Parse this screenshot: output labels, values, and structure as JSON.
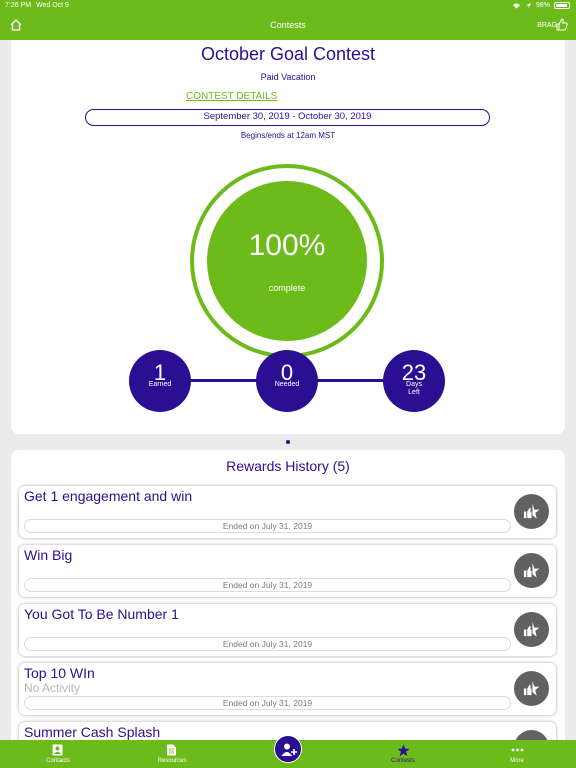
{
  "status_bar": {
    "time": "7:26 PM",
    "date": "Wed Oct 9",
    "battery": "98%"
  },
  "nav": {
    "title": "Contests",
    "brag_label": "BRAG"
  },
  "contest": {
    "title": "October Goal Contest",
    "prize": "Paid Vacation",
    "details_link": "CONTEST DETAILS",
    "date_range": "September 30, 2019 - October 30, 2019",
    "begins_ends": "Begins/ends at 12am MST",
    "progress_text": "100%",
    "progress_label": "complete",
    "progress_fraction": 1.0,
    "stats": {
      "earned": {
        "value": "1",
        "label": "Earned"
      },
      "needed": {
        "value": "0",
        "label": "Needed"
      },
      "days_left": {
        "value": "23",
        "label_top": "Days",
        "label_bottom": "Left"
      }
    }
  },
  "rewards": {
    "title": "Rewards History (5)",
    "items": [
      {
        "name": "Get 1 engagement and win",
        "activity": "",
        "ended": "Ended on July 31, 2019"
      },
      {
        "name": "Win Big",
        "activity": "",
        "ended": "Ended on July 31, 2019"
      },
      {
        "name": "You Got To Be Number 1",
        "activity": "",
        "ended": "Ended on July 31, 2019"
      },
      {
        "name": "Top 10 WIn",
        "activity": "No Activity",
        "ended": "Ended on July 31, 2019"
      },
      {
        "name": "Summer Cash Splash",
        "activity": "",
        "ended": ""
      }
    ]
  },
  "tabs": {
    "contacts": "Contacts",
    "resources": "Resources",
    "contests": "Contests",
    "more": "More"
  },
  "colors": {
    "brand_green": "#6dbb1a",
    "brand_indigo": "#2b0f93",
    "reward_button": "#616161"
  }
}
